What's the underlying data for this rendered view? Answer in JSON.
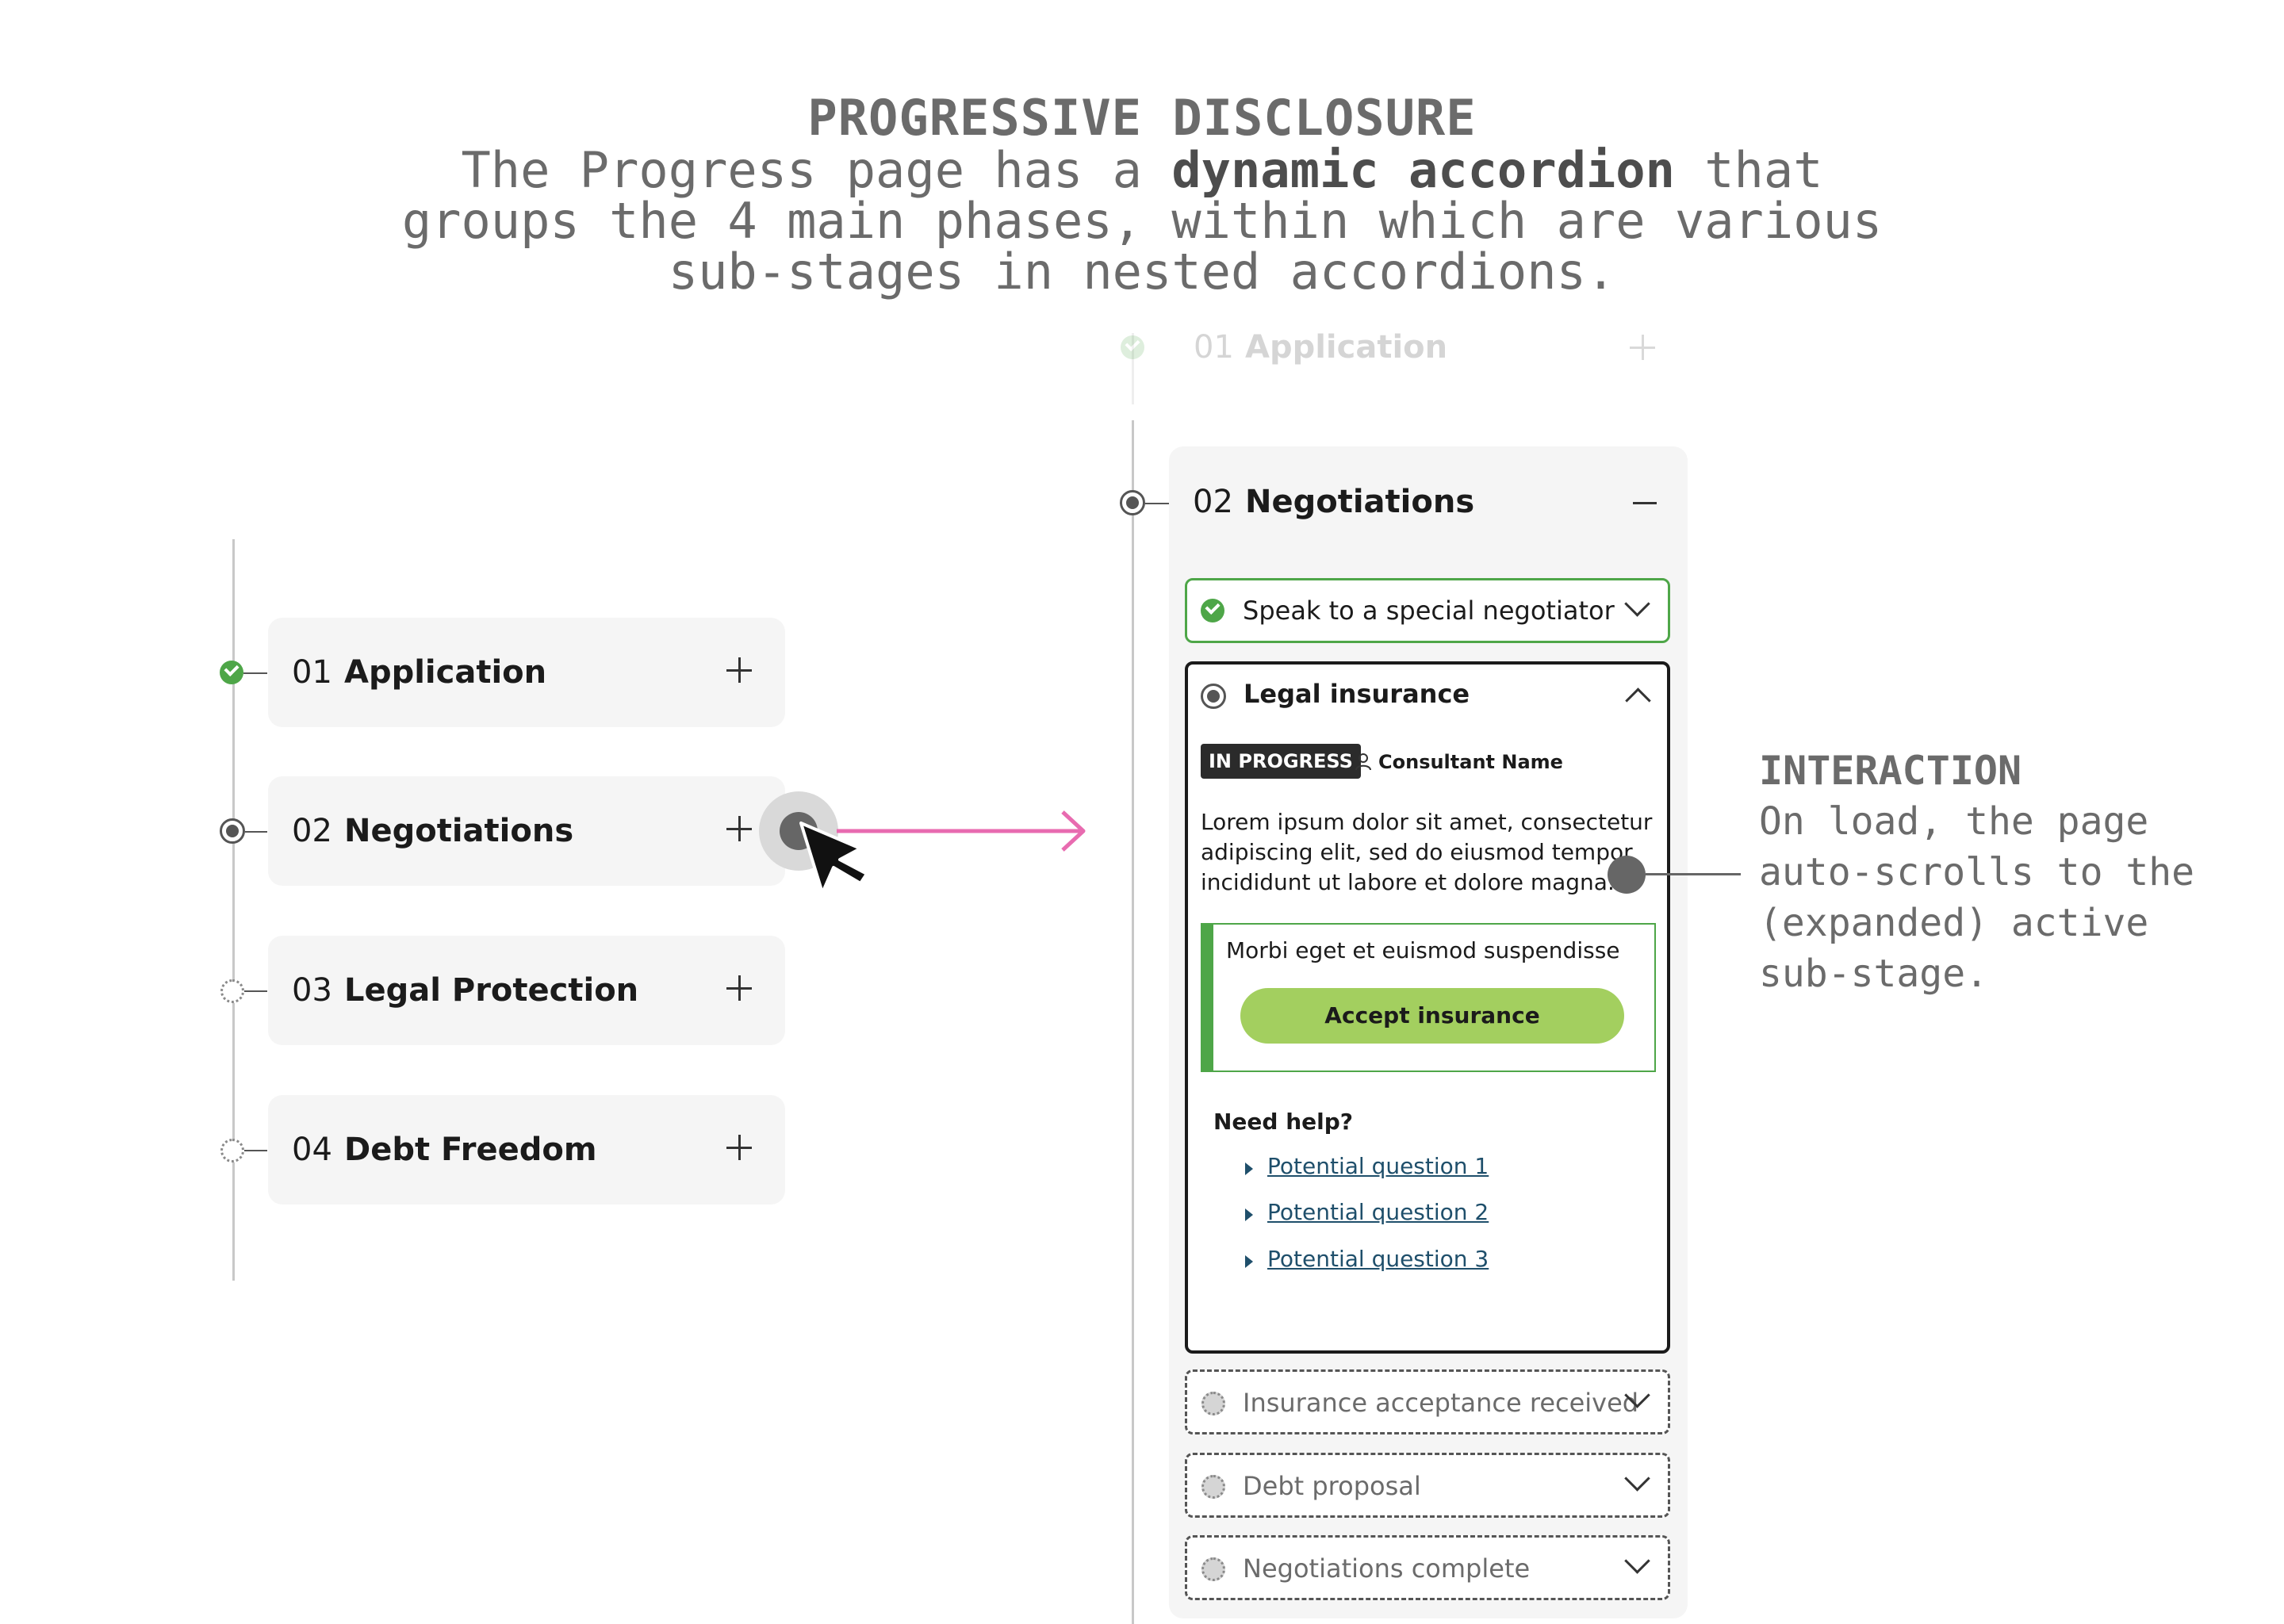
{
  "header": {
    "title": "PROGRESSIVE DISCLOSURE",
    "line1_pre": "The Progress page has a ",
    "line1_bold": "dynamic accordion",
    "line1_post": " that",
    "line2": "groups the 4 main phases, within which are various",
    "line3": "sub-stages in nested accordions."
  },
  "left_phases": [
    {
      "num": "01",
      "name": "Application",
      "status": "complete"
    },
    {
      "num": "02",
      "name": "Negotiations",
      "status": "active"
    },
    {
      "num": "03",
      "name": "Legal Protection",
      "status": "pending"
    },
    {
      "num": "04",
      "name": "Debt Freedom",
      "status": "pending"
    }
  ],
  "right": {
    "faded_phase": {
      "num": "01",
      "name": "Application"
    },
    "phase": {
      "num": "02",
      "name": "Negotiations"
    },
    "substages": {
      "s1": "Speak to a special negotiator",
      "s2": "Legal insurance",
      "s3": "Insurance acceptance received",
      "s4": "Debt proposal",
      "s5": "Negotiations complete"
    },
    "badge": "IN PROGRESS",
    "consultant": "Consultant Name",
    "lorem": [
      "Lorem ipsum dolor sit amet, consectetur",
      "adipiscing elit, sed do eiusmod tempor",
      "incididunt ut labore et dolore magna."
    ],
    "callout_text": "Morbi eget et euismod suspendisse",
    "accept_button": "Accept insurance",
    "help_title": "Need help?",
    "questions": [
      "Potential question 1",
      "Potential question 2",
      "Potential question 3"
    ]
  },
  "interaction": {
    "title": "INTERACTION",
    "lines": [
      "On load, the page",
      "auto-scrolls to the",
      "(expanded) active",
      "sub-stage."
    ]
  },
  "colors": {
    "green": "#4ea648",
    "accent_button": "#a3cf5f",
    "arrow": "#e86bb0",
    "badge_bg": "#2b2b2b"
  }
}
